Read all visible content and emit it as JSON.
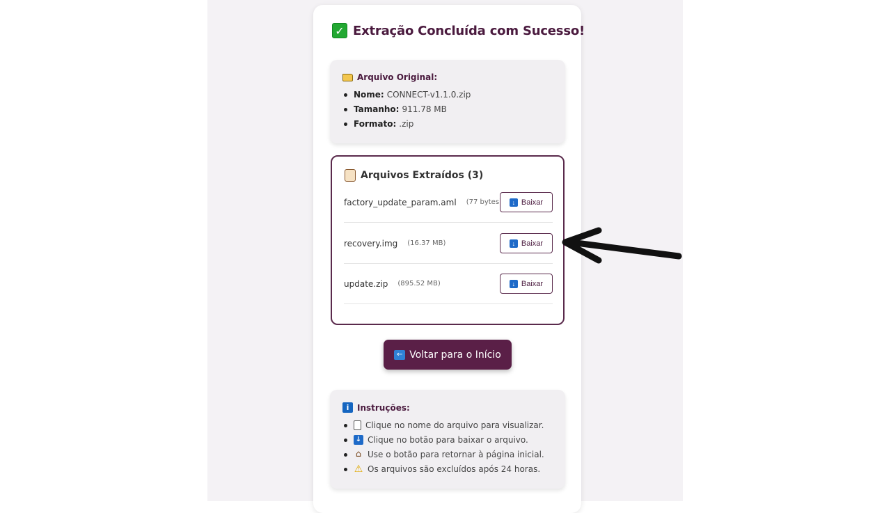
{
  "header": {
    "title": "Extração Concluída com Sucesso!",
    "icon": "check-icon"
  },
  "original": {
    "heading": "Arquivo Original:",
    "icon": "folder-icon",
    "items": [
      {
        "key": "Nome:",
        "value": "CONNECT-v1.1.0.zip"
      },
      {
        "key": "Tamanho:",
        "value": "911.78 MB"
      },
      {
        "key": "Formato:",
        "value": ".zip"
      }
    ]
  },
  "extracted": {
    "heading": "Arquivos Extraídos (3)",
    "icon": "scroll-icon",
    "files": [
      {
        "name": "factory_update_param.aml",
        "size": "(77 bytes)",
        "button": "Baixar"
      },
      {
        "name": "recovery.img",
        "size": "(16.37 MB)",
        "button": "Baixar"
      },
      {
        "name": "update.zip",
        "size": "(895.52 MB)",
        "button": "Baixar"
      }
    ]
  },
  "back_button": {
    "label": "Voltar para o Início",
    "icon": "back-arrow-icon"
  },
  "instructions": {
    "heading": "Instruções:",
    "icon": "info-icon",
    "items": [
      {
        "icon": "document-icon",
        "text": "Clique no nome do arquivo para visualizar."
      },
      {
        "icon": "download-icon",
        "text": "Clique no botão para baixar o arquivo."
      },
      {
        "icon": "house-icon",
        "text": "Use o botão para retornar à página inicial."
      },
      {
        "icon": "warning-icon",
        "text": "Os arquivos são excluídos após 24 horas."
      }
    ]
  },
  "colors": {
    "accent": "#5a1f47",
    "title": "#4a1a3e",
    "check": "#22a832",
    "info": "#1565c0"
  }
}
